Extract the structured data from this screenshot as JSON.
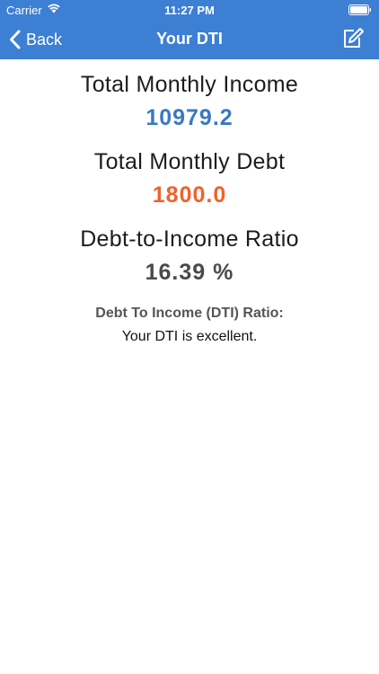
{
  "status_bar": {
    "carrier": "Carrier",
    "time": "11:27 PM",
    "wifi_icon": "wifi-icon",
    "battery_icon": "battery-icon"
  },
  "nav": {
    "back_label": "Back",
    "title": "Your DTI",
    "back_icon": "chevron-left-icon",
    "edit_icon": "edit-icon"
  },
  "summary": {
    "income_label": "Total Monthly Income",
    "income_value": "10979.2",
    "debt_label": "Total Monthly Debt",
    "debt_value": "1800.0",
    "ratio_label": "Debt-to-Income Ratio",
    "ratio_value": "16.39 %"
  },
  "assessment": {
    "heading": "Debt To Income (DTI) Ratio:",
    "message": "Your DTI is excellent."
  },
  "colors": {
    "nav_background": "#3d7fd3",
    "income_value": "#3a78c4",
    "debt_value": "#f0622a",
    "ratio_value": "#4a4a4a"
  }
}
